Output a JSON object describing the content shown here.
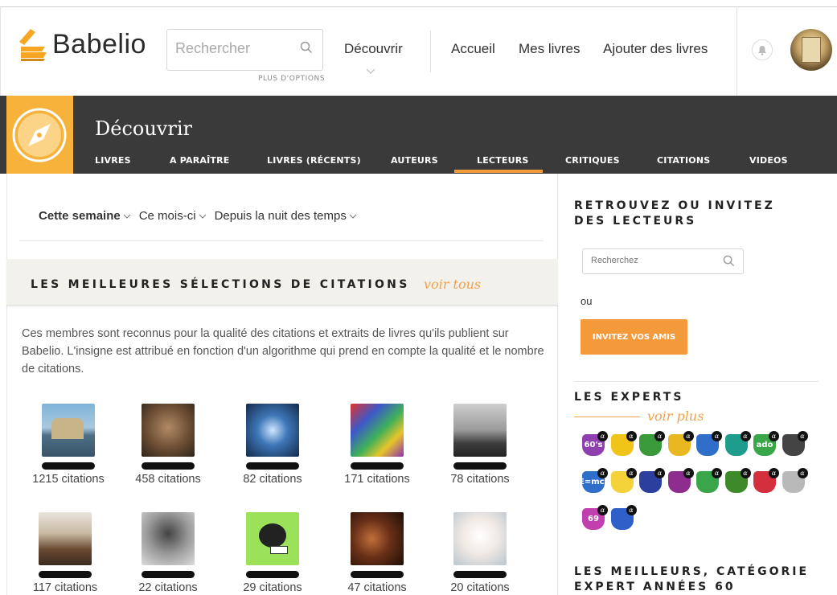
{
  "header": {
    "logo_text": "Babelio",
    "search_placeholder": "Rechercher",
    "more_options": "PLUS D'OPTIONS",
    "nav": {
      "discover": "Découvrir",
      "home": "Accueil",
      "my_books": "Mes livres",
      "add_books": "Ajouter des livres"
    }
  },
  "section": {
    "title": "Découvrir",
    "tabs": [
      "LIVRES",
      "A PARAÎTRE",
      "LIVRES (RÉCENTS)",
      "AUTEURS",
      "LECTEURS",
      "CRITIQUES",
      "CITATIONS",
      "VIDEOS"
    ],
    "active_tab": "LECTEURS"
  },
  "filters": [
    "Cette semaine",
    "Ce mois-ci",
    "Depuis la nuit des temps"
  ],
  "best_quotes": {
    "title": "LES MEILLEURES SÉLECTIONS DE CITATIONS",
    "see_all": "voir tous",
    "description": "Ces membres sont reconnus pour la qualité des citations et extraits de livres qu'ils publient sur Babelio. L'insigne est attribué en fonction d'un algorithme qui prend en compte la qualité et le nombre de citations.",
    "members": [
      {
        "count": "1215 citations"
      },
      {
        "count": "458 citations"
      },
      {
        "count": "82 citations"
      },
      {
        "count": "171 citations"
      },
      {
        "count": "78 citations"
      },
      {
        "count": "117 citations"
      },
      {
        "count": "22 citations"
      },
      {
        "count": "29 citations"
      },
      {
        "count": "47 citations"
      },
      {
        "count": "20 citations"
      }
    ]
  },
  "sidebar": {
    "find_title": "RETROUVEZ OU INVITEZ DES LECTEURS",
    "search_placeholder": "Recherchez",
    "or": "ou",
    "invite_button": "INVITEZ VOS AMIS",
    "experts_title": "LES EXPERTS",
    "see_more": "voir plus",
    "best_category_title": "LES MEILLEURS, CATÉGORIE EXPERT ANNÉES 60",
    "badges": [
      {
        "label": "60's",
        "color": "#8e3fb0"
      },
      {
        "label": "",
        "color": "#f0c419"
      },
      {
        "label": "",
        "color": "#3a9a3a"
      },
      {
        "label": "",
        "color": "#e9b820"
      },
      {
        "label": "",
        "color": "#2f6fc9"
      },
      {
        "label": "",
        "color": "#1e9c8c"
      },
      {
        "label": "ado",
        "color": "#3aa64a"
      },
      {
        "label": "",
        "color": "#444444"
      },
      {
        "label": "E=mc²",
        "color": "#2f6fc9"
      },
      {
        "label": "",
        "color": "#f3d23a"
      },
      {
        "label": "",
        "color": "#2d3f9e"
      },
      {
        "label": "",
        "color": "#8e2d8e"
      },
      {
        "label": "",
        "color": "#3aa64a"
      },
      {
        "label": "",
        "color": "#3e8a2a"
      },
      {
        "label": "",
        "color": "#d42f3c"
      },
      {
        "label": "",
        "color": "#b9b9b9"
      },
      {
        "label": "69",
        "color": "#c23fb0"
      },
      {
        "label": "",
        "color": "#2f5fc9"
      }
    ]
  },
  "colors": {
    "accent": "#f39c3c",
    "dark_band": "#3a3a3a",
    "link": "#f0a14a"
  }
}
